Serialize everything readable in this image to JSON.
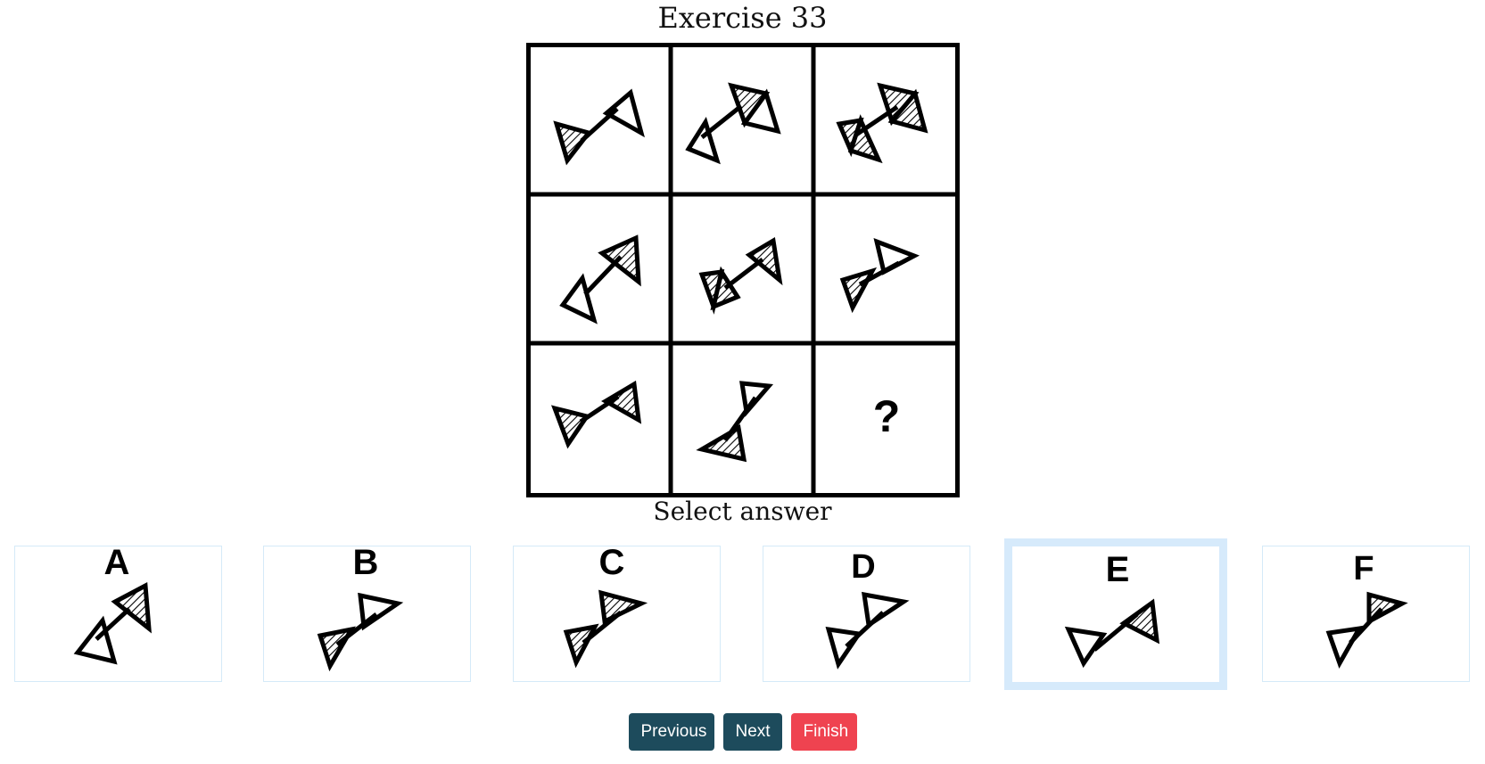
{
  "exercise_title": "Exercise 33",
  "question_mark": "?",
  "select_label": "Select answer",
  "options": [
    {
      "letter": "A"
    },
    {
      "letter": "B"
    },
    {
      "letter": "C"
    },
    {
      "letter": "D"
    },
    {
      "letter": "E",
      "selected": true
    },
    {
      "letter": "F"
    }
  ],
  "nav": {
    "previous_label": "Previous",
    "next_label": "Next",
    "finish_label": "Finish"
  },
  "colors": {
    "nav_button": "#1d4b5c",
    "finish_button": "#ef4350",
    "selected_border": "#d6eafb",
    "option_border": "#d5eaf8"
  }
}
